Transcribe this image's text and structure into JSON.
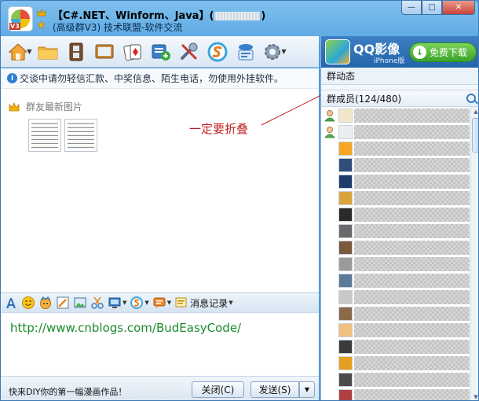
{
  "window": {
    "title_prefix": "【C#.NET、Winform、Java】(",
    "title_suffix": ")",
    "subtitle": "(高级群V3) 技术联盟-软件交流",
    "avatar_badge": "V3"
  },
  "window_controls": {
    "minimize": "—",
    "maximize": "□",
    "close": "✕"
  },
  "toolbar": {
    "items": [
      "home-menu",
      "folder",
      "film",
      "media",
      "game",
      "add",
      "tools",
      "share",
      "profile",
      "settings"
    ]
  },
  "notice": {
    "icon": "i",
    "text": "交谈中请勿轻信汇款、中奖信息、陌生电话，勿使用外挂软件。"
  },
  "chat": {
    "latest_images_label": "群友最新图片",
    "annotation": "一定要折叠"
  },
  "input_toolbar": {
    "message_history_label": "消息记录"
  },
  "input": {
    "text": "http://www.cnblogs.com/BudEasyCode/"
  },
  "bottom": {
    "promo": "快来DIY你的第一幅漫画作品！",
    "close_label": "关闭(C)",
    "send_label": "发送(S)",
    "send_dropdown": "▼"
  },
  "right_panel": {
    "ad": {
      "brand": "QQ影像",
      "sub": "iPhone版",
      "download_label": "免费下载",
      "download_icon": "↓"
    },
    "dynamics_title": "群动态",
    "members_title": "群成员(124/480)"
  },
  "colors": {
    "annotation": "#c32020",
    "url": "#1a8c2e",
    "frame": "#4f9be0"
  }
}
